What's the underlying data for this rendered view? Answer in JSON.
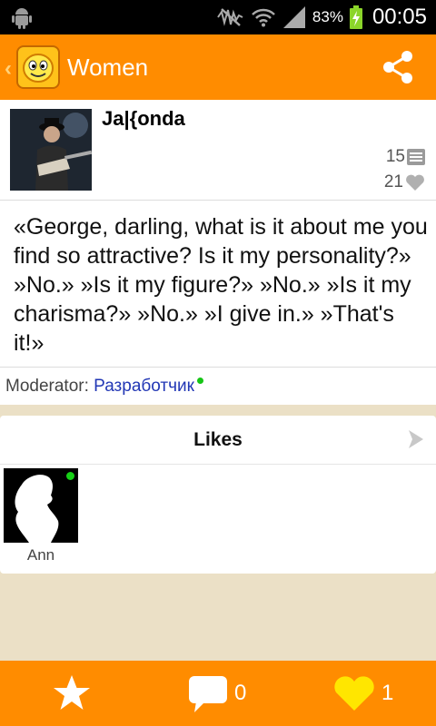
{
  "status_bar": {
    "battery_percent": "83%",
    "time": "00:05",
    "icons": [
      "android-icon",
      "mute-icon",
      "wifi-icon",
      "signal-icon",
      "battery-charging-icon"
    ]
  },
  "toolbar": {
    "title": "Women",
    "back_icon": "chevron-left-icon",
    "logo_icon": "smiley-icon",
    "share_icon": "share-icon"
  },
  "post": {
    "author": "Ja|{onda",
    "comments_count": "15",
    "likes_count": "21",
    "text": "«George, darling, what is it about me you find so attractive? Is it my personality?» »No.» »Is it my figure?» »No.» »Is it my charisma?» »No.» »I give in.»  »That's it!»",
    "moderator_label": "Moderator:",
    "moderator_name": "Разработчик"
  },
  "likes": {
    "title": "Likes",
    "users": [
      {
        "name": "Ann",
        "online": true
      }
    ]
  },
  "bottom_bar": {
    "comments_count": "0",
    "likes_count": "1"
  },
  "colors": {
    "accent": "#ff8c00",
    "background": "#ebe0c6",
    "like_heart": "#ffe600",
    "moderator_link": "#2237b5",
    "online": "#16c516"
  }
}
